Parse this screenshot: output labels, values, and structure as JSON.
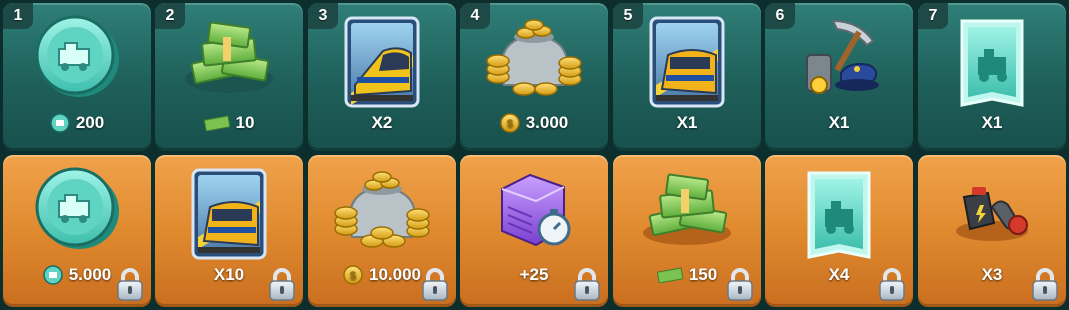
{
  "free_track": [
    {
      "day": "1",
      "reward": "coin-icon",
      "label": "200"
    },
    {
      "day": "2",
      "reward": "cash-icon",
      "label": "10"
    },
    {
      "day": "3",
      "reward": "train-card-icon",
      "label": "X2"
    },
    {
      "day": "4",
      "reward": "gold-coins-icon",
      "label": "3.000"
    },
    {
      "day": "5",
      "reward": "train-card-icon",
      "label": "X1"
    },
    {
      "day": "6",
      "reward": "tools-icon",
      "label": "X1"
    },
    {
      "day": "7",
      "reward": "blueprint-icon",
      "label": "X1"
    }
  ],
  "premium_track": [
    {
      "reward": "coin-icon",
      "label": "5.000",
      "locked": true
    },
    {
      "reward": "train-card-icon",
      "label": "X10",
      "locked": true
    },
    {
      "reward": "gold-coins-icon",
      "label": "10.000",
      "locked": true
    },
    {
      "reward": "depot-speedup-icon",
      "label": "+25",
      "locked": true
    },
    {
      "reward": "cash-icon",
      "label": "150",
      "locked": true
    },
    {
      "reward": "blueprint-icon",
      "label": "X4",
      "locked": true
    },
    {
      "reward": "tools-icon",
      "label": "X3",
      "locked": true
    }
  ],
  "colors": {
    "free_bg": "#2f7f78",
    "premium_bg": "#e08a2f",
    "badge": "#1d4a47"
  }
}
